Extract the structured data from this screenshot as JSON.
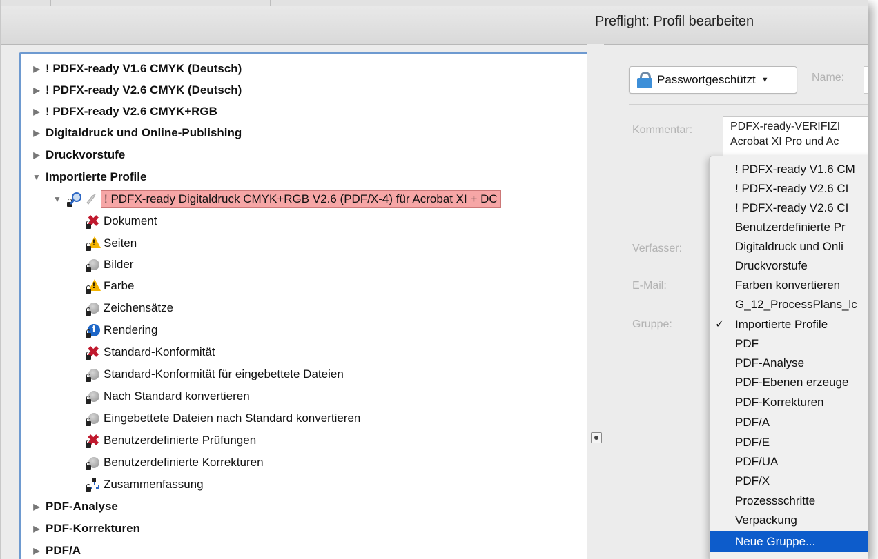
{
  "window": {
    "title": "Preflight: Profil bearbeiten"
  },
  "tree": {
    "groups_top": [
      {
        "label": "! PDFX-ready V1.6 CMYK (Deutsch)"
      },
      {
        "label": "! PDFX-ready V2.6 CMYK (Deutsch)"
      },
      {
        "label": "! PDFX-ready V2.6 CMYK+RGB"
      },
      {
        "label": "Digitaldruck und Online-Publishing"
      },
      {
        "label": "Druckvorstufe"
      },
      {
        "label": "Importierte Profile"
      }
    ],
    "profile": {
      "label": "! PDFX-ready Digitaldruck CMYK+RGB V2.6 (PDF/X-4) für Acrobat XI + DC"
    },
    "children": [
      {
        "label": "Dokument",
        "icon": "error-x-icon"
      },
      {
        "label": "Seiten",
        "icon": "warning-icon"
      },
      {
        "label": "Bilder",
        "icon": "inactive-gray-icon"
      },
      {
        "label": "Farbe",
        "icon": "warning-icon"
      },
      {
        "label": "Zeichensätze",
        "icon": "inactive-gray-icon"
      },
      {
        "label": "Rendering",
        "icon": "info-icon"
      },
      {
        "label": "Standard-Konformität",
        "icon": "error-x-icon"
      },
      {
        "label": "Standard-Konformität für eingebettete Dateien",
        "icon": "inactive-gray-icon"
      },
      {
        "label": "Nach Standard konvertieren",
        "icon": "inactive-gray-icon"
      },
      {
        "label": "Eingebettete Dateien nach Standard konvertieren",
        "icon": "inactive-gray-icon"
      },
      {
        "label": "Benutzerdefinierte Prüfungen",
        "icon": "error-x-icon"
      },
      {
        "label": "Benutzerdefinierte Korrekturen",
        "icon": "inactive-gray-icon"
      },
      {
        "label": "Zusammenfassung",
        "icon": "summary-network-icon"
      }
    ],
    "groups_bottom": [
      {
        "label": "PDF-Analyse"
      },
      {
        "label": "PDF-Korrekturen"
      },
      {
        "label": "PDF/A"
      }
    ]
  },
  "form": {
    "password_button": "Passwortgeschützt",
    "name_label": "Name:",
    "comment_label": "Kommentar:",
    "comment_line1": "PDFX-ready-VERIFIZI",
    "comment_line2": "Acrobat XI Pro und Ac",
    "author_label": "Verfasser:",
    "email_label": "E-Mail:",
    "group_label": "Gruppe:"
  },
  "group_menu": {
    "selected": "Importierte Profile",
    "items": [
      "! PDFX-ready V1.6 CM",
      "! PDFX-ready V2.6 CI",
      "! PDFX-ready V2.6 CI",
      "Benutzerdefinierte Pr",
      "Digitaldruck und Onli",
      "Druckvorstufe",
      "Farben konvertieren",
      "G_12_ProcessPlans_lc",
      "Importierte Profile",
      "PDF",
      "PDF-Analyse",
      "PDF-Ebenen erzeuge",
      "PDF-Korrekturen",
      "PDF/A",
      "PDF/E",
      "PDF/UA",
      "PDF/X",
      "Prozessschritte",
      "Verpackung",
      "Neue Gruppe..."
    ],
    "highlighted": "Neue Gruppe...",
    "checkmark": "✓"
  },
  "colors": {
    "selection_blue": "#0d5ccb",
    "profile_highlight": "#f6a6a6",
    "error_red": "#c0192e",
    "warning_yellow": "#f4b400",
    "info_blue": "#1c66c8"
  }
}
